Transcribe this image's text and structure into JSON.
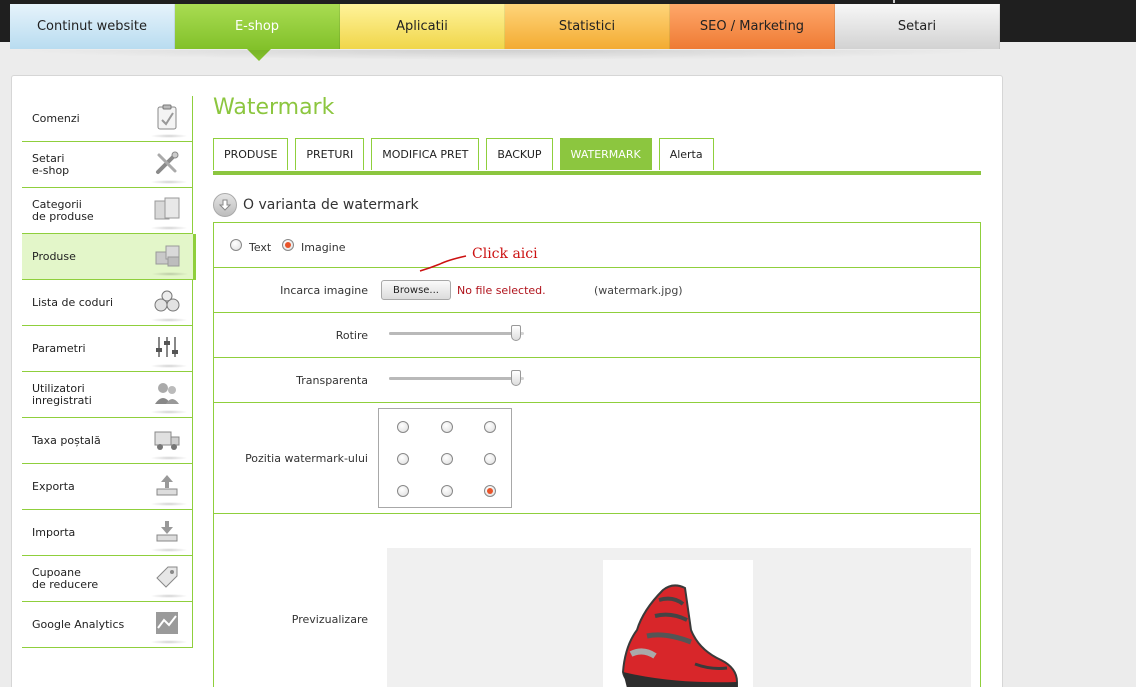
{
  "topnav": {
    "tabs": [
      {
        "label": "Continut website"
      },
      {
        "label": "E-shop"
      },
      {
        "label": "Aplicatii"
      },
      {
        "label": "Statistici"
      },
      {
        "label": "SEO / Marketing"
      },
      {
        "label": "Setari"
      }
    ],
    "active_index": 1
  },
  "sidebar": {
    "items": [
      {
        "line1": "Comenzi",
        "line2": "",
        "icon": "clipboard-icon"
      },
      {
        "line1": "Setari",
        "line2": "e-shop",
        "icon": "tools-icon"
      },
      {
        "line1": "Categorii",
        "line2": "de produse",
        "icon": "folder-icon"
      },
      {
        "line1": "Produse",
        "line2": "",
        "icon": "boxes-icon"
      },
      {
        "line1": "Lista de coduri",
        "line2": "",
        "icon": "coins-icon"
      },
      {
        "line1": "Parametri",
        "line2": "",
        "icon": "sliders-icon"
      },
      {
        "line1": "Utilizatori",
        "line2": "inregistrati",
        "icon": "users-icon"
      },
      {
        "line1": "Taxa poștală",
        "line2": "",
        "icon": "truck-icon"
      },
      {
        "line1": "Exporta",
        "line2": "",
        "icon": "upload-icon"
      },
      {
        "line1": "Importa",
        "line2": "",
        "icon": "download-icon"
      },
      {
        "line1": "Cupoane",
        "line2": "de reducere",
        "icon": "tag-icon"
      },
      {
        "line1": "Google Analytics",
        "line2": "",
        "icon": "chart-icon"
      }
    ],
    "active_index": 3
  },
  "page": {
    "title": "Watermark",
    "tabs": [
      "PRODUSE",
      "PRETURI",
      "MODIFICA PRET",
      "BACKUP",
      "WATERMARK",
      "Alerta"
    ],
    "active_tab": 4,
    "section_title": "O varianta de watermark"
  },
  "form": {
    "type_text_label": "Text",
    "type_image_label": "Imagine",
    "type_selected": "Imagine",
    "upload_label": "Incarca imagine",
    "browse_label": "Browse...",
    "no_file_text": "No file selected.",
    "current_file": "(watermark.jpg)",
    "rotation_label": "Rotire",
    "rotation_value_fraction": 0.94,
    "transparency_label": "Transparenta",
    "transparency_value_fraction": 0.94,
    "position_label": "Pozitia watermark-ului",
    "position_selected": "bottom-right",
    "preview_label": "Previzualizare"
  },
  "annotation": {
    "text": "Click  aici",
    "color": "#cc1111"
  },
  "colors": {
    "accent_green": "#8cc63f",
    "error_red": "#b0121b"
  }
}
